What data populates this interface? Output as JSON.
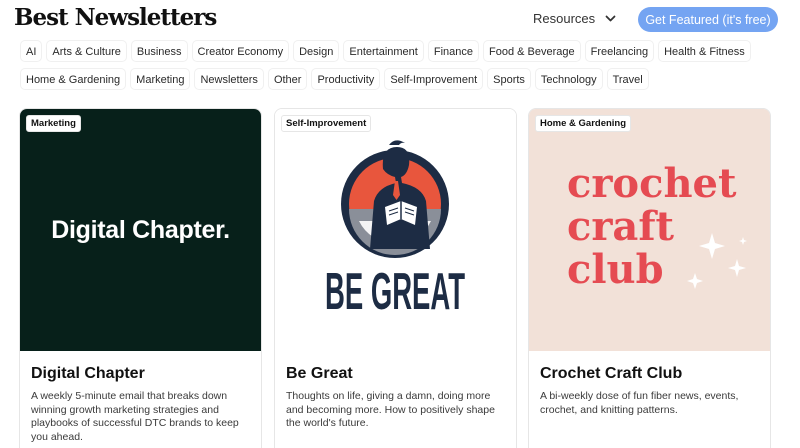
{
  "header": {
    "logo": "Best Newsletters",
    "resources_label": "Resources",
    "cta_label": "Get Featured (it's free)"
  },
  "categories": {
    "row1": [
      "AI",
      "Arts & Culture",
      "Business",
      "Creator Economy",
      "Design",
      "Entertainment",
      "Finance",
      "Food & Beverage",
      "Freelancing",
      "Health & Fitness"
    ],
    "row2": [
      "Home & Gardening",
      "Marketing",
      "Newsletters",
      "Other",
      "Productivity",
      "Self-Improvement",
      "Sports",
      "Technology",
      "Travel"
    ]
  },
  "cards": [
    {
      "tag": "Marketing",
      "thumb_text": "Digital Chapter.",
      "title": "Digital Chapter",
      "description": "A weekly 5-minute email that breaks down winning growth marketing strategies and playbooks of successful DTC brands to keep you ahead."
    },
    {
      "tag": "Self-Improvement",
      "thumb_text": "BE GREAT",
      "title": "Be Great",
      "description": "Thoughts on life, giving a damn, doing more and becoming more. How to positively shape the world's future."
    },
    {
      "tag": "Home & Gardening",
      "thumb_lines": [
        "crochet",
        "craft",
        "club"
      ],
      "title": "Crochet Craft Club",
      "description": "A bi-weekly dose of fun fiber news, events, crochet, and knitting patterns."
    }
  ],
  "colors": {
    "cta": "#74a4f2",
    "digital_chapter_bg": "#07201a",
    "be_great_navy": "#1d2c44",
    "be_great_red": "#e8563d",
    "crochet_bg": "#f2e1d8",
    "crochet_text": "#e54b52"
  },
  "icons": [
    "chevron-down-icon",
    "sparkle-icon"
  ]
}
